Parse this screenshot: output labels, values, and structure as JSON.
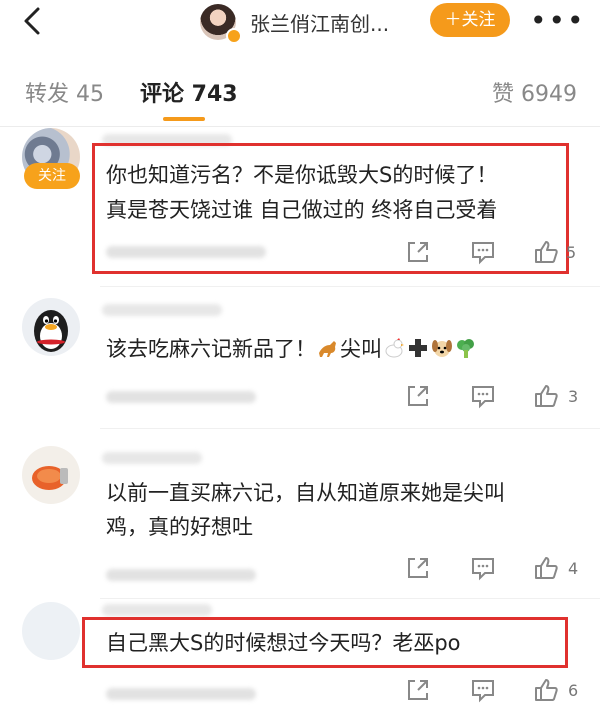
{
  "header": {
    "title": "张兰俏江南创...",
    "follow_label": "＋关注",
    "more_label": "•••"
  },
  "tabs": [
    {
      "label": "转发 45"
    },
    {
      "label": "评论 743"
    },
    {
      "label": "赞 6949"
    }
  ],
  "comments": [
    {
      "follow_tag": "关注",
      "lines": [
        "你也知道污名？不是你诋毁大S的时候了！",
        "真是苍天饶过谁 自己做过的 终将自己受着"
      ],
      "likes": "5"
    },
    {
      "text_a": "该去吃麻六记新品了！",
      "text_b": "尖叫",
      "likes": "3"
    },
    {
      "lines": [
        "以前一直买麻六记，自从知道原来她是尖叫",
        "鸡，真的好想吐"
      ],
      "likes": "4"
    },
    {
      "text": "自己黑大S的时候想过今天吗？老巫po",
      "likes": "6"
    }
  ],
  "colors": {
    "accent": "#f59a1b",
    "highlight_border": "#e0312e"
  }
}
